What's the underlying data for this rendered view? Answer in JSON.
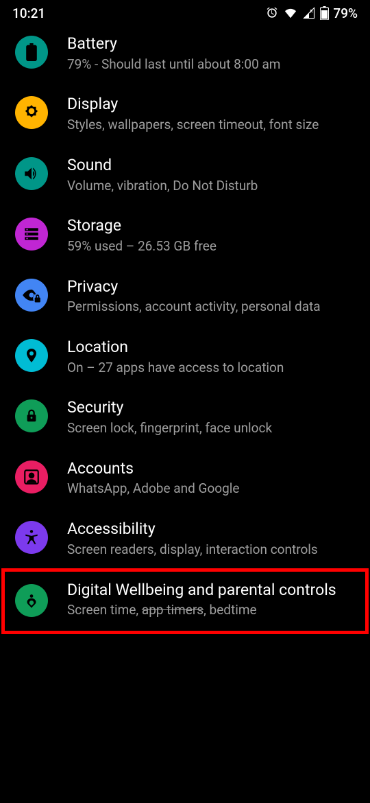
{
  "status": {
    "time": "10:21",
    "battery_pct": "79%"
  },
  "items": [
    {
      "id": "battery",
      "title": "Battery",
      "subtitle": "79% - Should last until about 8:00 am",
      "icon_bg": "#009688"
    },
    {
      "id": "display",
      "title": "Display",
      "subtitle": "Styles, wallpapers, screen timeout, font size",
      "icon_bg": "#ffb300"
    },
    {
      "id": "sound",
      "title": "Sound",
      "subtitle": "Volume, vibration, Do Not Disturb",
      "icon_bg": "#009688"
    },
    {
      "id": "storage",
      "title": "Storage",
      "subtitle": "59% used – 26.53 GB free",
      "icon_bg": "#c026d3"
    },
    {
      "id": "privacy",
      "title": "Privacy",
      "subtitle": "Permissions, account activity, personal data",
      "icon_bg": "#4285f4"
    },
    {
      "id": "location",
      "title": "Location",
      "subtitle": "On – 27 apps have access to location",
      "icon_bg": "#00bcd4"
    },
    {
      "id": "security",
      "title": "Security",
      "subtitle": "Screen lock, fingerprint, face unlock",
      "icon_bg": "#0f9d58"
    },
    {
      "id": "accounts",
      "title": "Accounts",
      "subtitle": "WhatsApp, Adobe and Google",
      "icon_bg": "#e91e63"
    },
    {
      "id": "accessibility",
      "title": "Accessibility",
      "subtitle": "Screen readers, display, interaction controls",
      "icon_bg": "#7c3aed"
    },
    {
      "id": "wellbeing",
      "title": "Digital Wellbeing and parental controls",
      "subtitle_pre": "Screen time, ",
      "subtitle_strike": "app timers",
      "subtitle_post": ", bedtime",
      "icon_bg": "#0f9d58"
    }
  ],
  "highlight_item": "accounts"
}
